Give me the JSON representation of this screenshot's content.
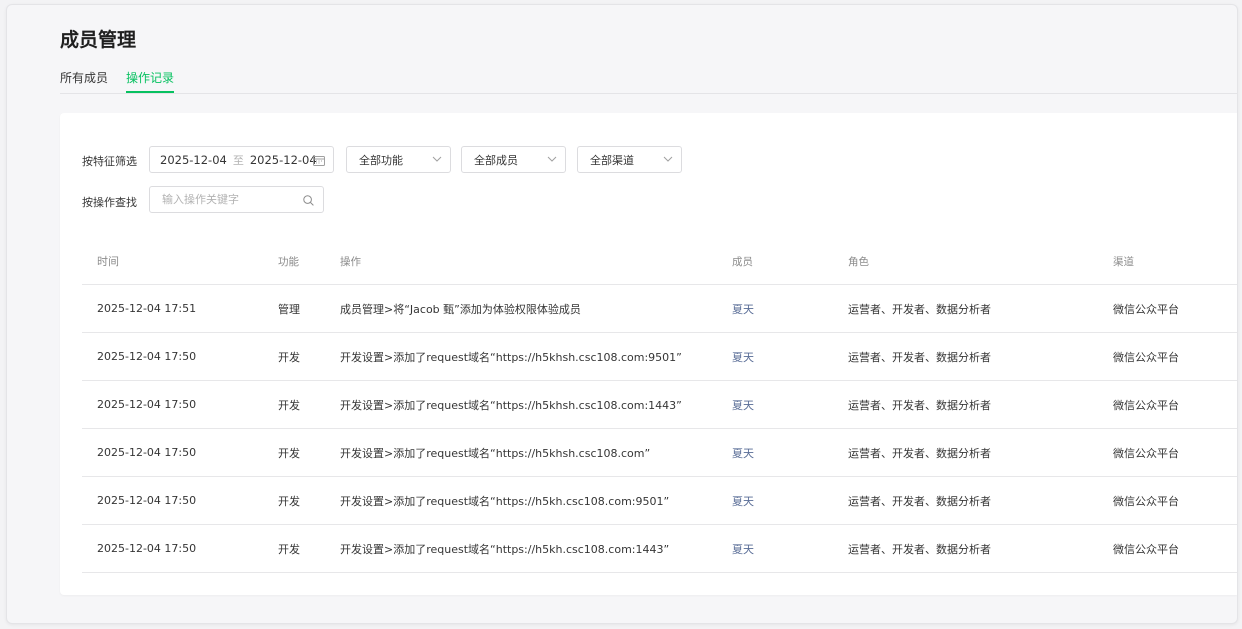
{
  "page": {
    "title": "成员管理"
  },
  "tabs": [
    {
      "label": "所有成员",
      "active": false
    },
    {
      "label": "操作记录",
      "active": true
    }
  ],
  "filters": {
    "feature_label": "按特征筛选",
    "date_start": "2025-12-04",
    "date_separator": "至",
    "date_end": "2025-12-04",
    "function_select": "全部功能",
    "member_select": "全部成员",
    "channel_select": "全部渠道",
    "search_label": "按操作查找",
    "search_placeholder": "输入操作关键字",
    "search_value": ""
  },
  "table": {
    "headers": {
      "time": "时间",
      "function": "功能",
      "operation": "操作",
      "member": "成员",
      "role": "角色",
      "channel": "渠道"
    },
    "rows": [
      {
        "time": "2025-12-04 17:51",
        "function": "管理",
        "operation": "成员管理>将“Jacob 甄”添加为体验权限体验成员",
        "member": "夏天",
        "role": "运营者、开发者、数据分析者",
        "channel": "微信公众平台"
      },
      {
        "time": "2025-12-04 17:50",
        "function": "开发",
        "operation": "开发设置>添加了request域名“https://h5khsh.csc108.com:9501”",
        "member": "夏天",
        "role": "运营者、开发者、数据分析者",
        "channel": "微信公众平台"
      },
      {
        "time": "2025-12-04 17:50",
        "function": "开发",
        "operation": "开发设置>添加了request域名“https://h5khsh.csc108.com:1443”",
        "member": "夏天",
        "role": "运营者、开发者、数据分析者",
        "channel": "微信公众平台"
      },
      {
        "time": "2025-12-04 17:50",
        "function": "开发",
        "operation": "开发设置>添加了request域名“https://h5khsh.csc108.com”",
        "member": "夏天",
        "role": "运营者、开发者、数据分析者",
        "channel": "微信公众平台"
      },
      {
        "time": "2025-12-04 17:50",
        "function": "开发",
        "operation": "开发设置>添加了request域名“https://h5kh.csc108.com:9501”",
        "member": "夏天",
        "role": "运营者、开发者、数据分析者",
        "channel": "微信公众平台"
      },
      {
        "time": "2025-12-04 17:50",
        "function": "开发",
        "operation": "开发设置>添加了request域名“https://h5kh.csc108.com:1443”",
        "member": "夏天",
        "role": "运营者、开发者、数据分析者",
        "channel": "微信公众平台"
      }
    ]
  },
  "colors": {
    "accent": "#07c160",
    "link": "#576b95"
  },
  "icons": {
    "date": "calendar-icon",
    "select": "chevron-down-icon",
    "search": "search-icon"
  }
}
